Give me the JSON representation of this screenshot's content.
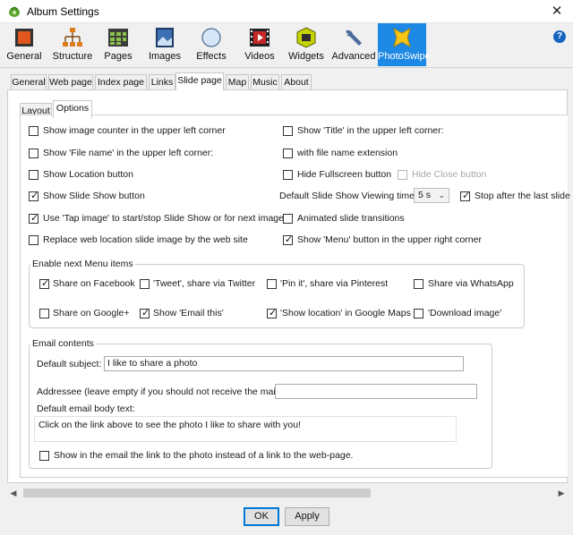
{
  "window": {
    "title": "Album Settings",
    "close_glyph": "✕"
  },
  "toolbar": {
    "items": [
      {
        "label": "General",
        "icon": "general-icon"
      },
      {
        "label": "Structure",
        "icon": "structure-icon"
      },
      {
        "label": "Pages",
        "icon": "pages-icon"
      },
      {
        "label": "Images",
        "icon": "images-icon"
      },
      {
        "label": "Effects",
        "icon": "effects-icon"
      },
      {
        "label": "Videos",
        "icon": "videos-icon"
      },
      {
        "label": "Widgets",
        "icon": "widgets-icon"
      },
      {
        "label": "Advanced",
        "icon": "advanced-icon"
      },
      {
        "label": "PhotoSwipe",
        "icon": "photoswipe-icon",
        "active": true
      }
    ],
    "help": "?"
  },
  "tabs": [
    "General",
    "Web page",
    "Index page",
    "Links",
    "Slide page",
    "Map",
    "Music",
    "About"
  ],
  "active_tab": "Slide page",
  "subtabs": [
    "Layout",
    "Options"
  ],
  "active_subtab": "Options",
  "options": {
    "image_counter": {
      "label": "Show image counter in the upper left corner",
      "checked": false
    },
    "show_title": {
      "label": "Show 'Title' in the upper left corner:",
      "checked": false
    },
    "show_file_name": {
      "label": "Show 'File name' in the upper left corner:",
      "checked": false
    },
    "file_name_extension": {
      "label": "with file name extension",
      "checked": false
    },
    "show_location_button": {
      "label": "Show Location button",
      "checked": false
    },
    "hide_fullscreen_button": {
      "label": "Hide Fullscreen button",
      "checked": false
    },
    "hide_close_button": {
      "label": "Hide Close button",
      "checked": false,
      "disabled": true
    },
    "show_slideshow_button": {
      "label": "Show Slide Show button",
      "checked": true
    },
    "slideshow_time_label": "Default Slide Show Viewing time:",
    "slideshow_time_value": "5 s",
    "stop_after_last": {
      "label": "Stop after the last slide",
      "checked": true
    },
    "tap_image": {
      "label": "Use 'Tap image' to start/stop Slide Show or for next image",
      "checked": true
    },
    "animated_transitions": {
      "label": "Animated slide transitions",
      "checked": false
    },
    "replace_location": {
      "label": "Replace web location slide image by the web site",
      "checked": false
    },
    "show_menu_button": {
      "label": "Show 'Menu' button in the upper right corner",
      "checked": true
    }
  },
  "menu_items": {
    "title": "Enable next Menu items",
    "share_facebook": {
      "label": "Share on Facebook",
      "checked": true
    },
    "tweet": {
      "label": "'Tweet', share via Twitter",
      "checked": false
    },
    "pin_it": {
      "label": "'Pin it', share via Pinterest",
      "checked": false
    },
    "whatsapp": {
      "label": "Share via WhatsApp",
      "checked": false
    },
    "google_plus": {
      "label": "Share on Google+",
      "checked": false
    },
    "email_this": {
      "label": "Show 'Email this'",
      "checked": true
    },
    "show_location_maps": {
      "label": "'Show location' in Google Maps",
      "checked": true
    },
    "download_image": {
      "label": "'Download image'",
      "checked": false
    }
  },
  "email": {
    "title": "Email contents",
    "subject_label": "Default subject:",
    "subject_value": "I like to share a photo",
    "addressee_label": "Addressee (leave empty if you should not receive the mail):",
    "addressee_value": "",
    "body_label": "Default email body text:",
    "body_value": "Click on the link above to see the photo I like to share with you!",
    "link_to_photo": {
      "label": "Show in the email the link to the photo instead of a link to the web-page.",
      "checked": false
    }
  },
  "scrollbar": {
    "left": "◀",
    "right": "▶"
  },
  "buttons": {
    "ok": "OK",
    "apply": "Apply"
  },
  "colors": {
    "active_toolbar": "#1e88e5",
    "help": "#1565c0"
  }
}
